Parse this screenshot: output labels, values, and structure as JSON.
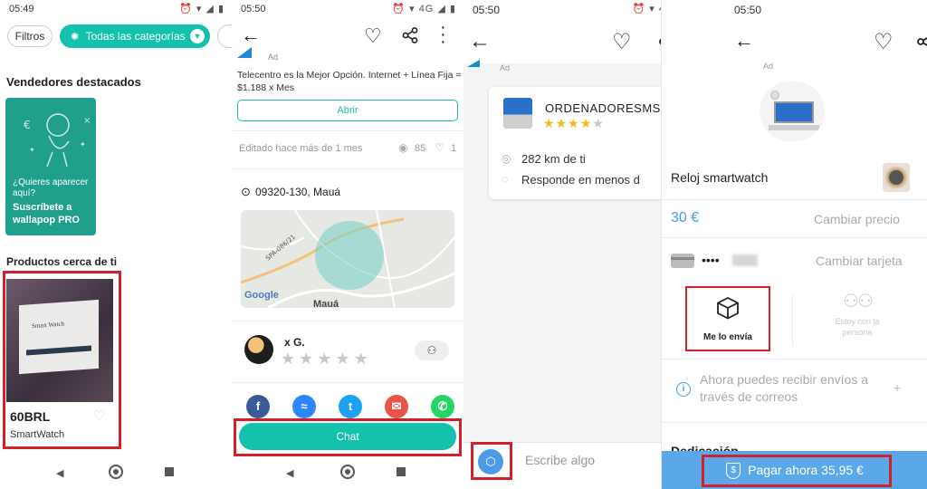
{
  "screen1": {
    "time": "05:49",
    "status_icons": "⏰ ▾ ◢ ▮",
    "filters_label": "Filtros",
    "category_label": "Todas las categorías",
    "featured_title": "Vendedores destacados",
    "promo_text1": "¿Quieres aparecer aquí?",
    "promo_text2": "Suscríbete a wallapop PRO",
    "nearby_title": "Productos cerca de ti",
    "product_image_text": "Smart Watch",
    "product_price": "60BRL",
    "product_name": "SmartWatch"
  },
  "screen2": {
    "time": "05:50",
    "status_icons": "⏰ ▾ 4G ◢ ▮",
    "ad_label": "Ad",
    "ad_text": "Telecentro es la Mejor Opción. Internet + Línea Fija = $1.188 x Mes",
    "open_button": "Abrir",
    "edited_text": "Editado hace más de 1 mes",
    "views_count": "85",
    "likes_count": "1",
    "location": "09320-130, Mauá",
    "map_logo": "Google",
    "map_city": "Mauá",
    "map_road": "SPA-086/21",
    "seller_name": "x G.",
    "chat_button": "Chat"
  },
  "screen3": {
    "time": "05:50",
    "status_icons": "⏰ ▾ 4G ◢",
    "ad_label": "Ad",
    "seller_name": "ORDENADORESMS",
    "distance": "282 km de ti",
    "response": "Responde en menos d",
    "rating": 4,
    "input_placeholder": "Escribe algo"
  },
  "screen4": {
    "time": "05:50",
    "ad_label": "Ad",
    "product_name": "Reloj smartwatch",
    "price": "30 €",
    "change_price": "Cambiar precio",
    "card_dots": "••••",
    "change_card": "Cambiar tarjeta",
    "ship_option": "Me lo envía",
    "meet_option": "Estoy con la persona",
    "info_text": "Ahora puedes recibir envíos a través de correos",
    "info_plus": "+",
    "next_section": "Dedicación",
    "pay_button": "Pagar ahora 35,95 €"
  },
  "colors": {
    "teal": "#13c1ac",
    "red_highlight": "#d4202a",
    "pay_blue": "#5aa8e8",
    "promo_bg": "#1f9f8c"
  }
}
